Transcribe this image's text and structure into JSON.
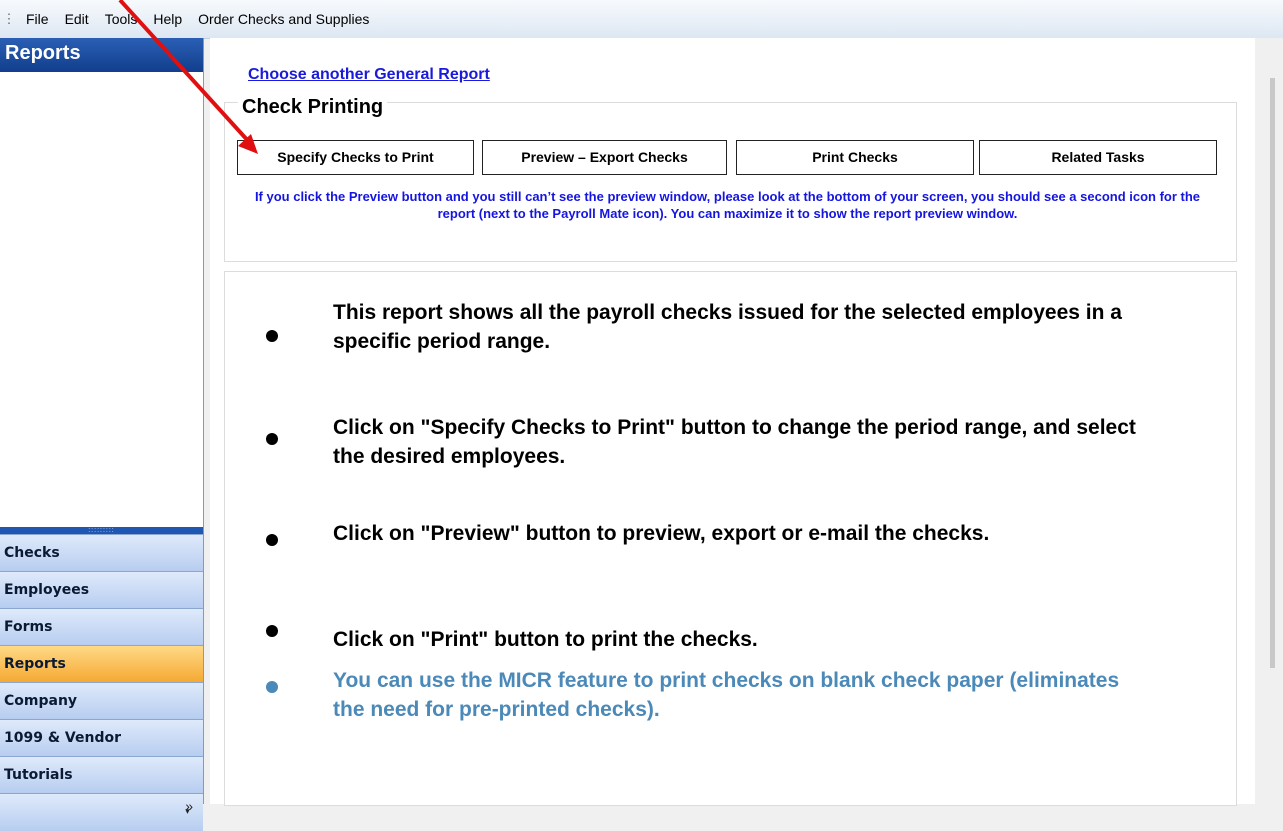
{
  "menu": {
    "items": [
      "File",
      "Edit",
      "Tools",
      "Help",
      "Order Checks and Supplies"
    ]
  },
  "nav": {
    "header": "Reports",
    "items": [
      {
        "label": "Checks",
        "active": false
      },
      {
        "label": "Employees",
        "active": false
      },
      {
        "label": "Forms",
        "active": false
      },
      {
        "label": "Reports",
        "active": true
      },
      {
        "label": "Company",
        "active": false
      },
      {
        "label": "1099 & Vendor",
        "active": false
      },
      {
        "label": "Tutorials",
        "active": false
      }
    ],
    "more_icon": "chevron-double-right-icon"
  },
  "main": {
    "link": "Choose another General Report",
    "group_title": "Check Printing",
    "buttons": {
      "specify": "Specify Checks to Print",
      "preview": "Preview – Export Checks",
      "print": "Print Checks",
      "related": "Related Tasks"
    },
    "note": "If you click the Preview button and you still can’t see the preview window, please look at the bottom of your screen, you should see a second icon for the report (next to the Payroll Mate icon). You can maximize it to show the report preview window.",
    "bullets": [
      "This report shows all the payroll checks issued for the selected employees in a specific period range.",
      "Click on \"Specify Checks to Print\" button to change the period range, and select the desired employees.",
      "Click on \"Preview\" button to preview, export or e-mail the checks.",
      "Click on \"Print\" button to print the checks.",
      "You can use the MICR feature to print checks on blank check paper (eliminates the need for pre-printed checks)."
    ]
  },
  "colors": {
    "nav_header": "#1f4fa3",
    "active_tab": "#f5a933",
    "link": "#1a1adb",
    "note": "#1515e0",
    "tip": "#4b89b8",
    "annotation_arrow": "#e01010"
  }
}
